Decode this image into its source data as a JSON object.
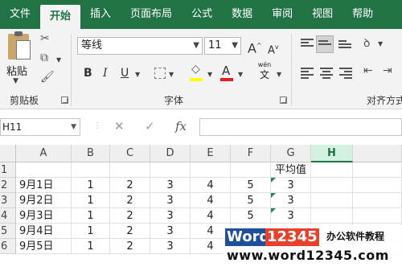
{
  "ribbon_tabs": [
    "文件",
    "开始",
    "插入",
    "页面布局",
    "公式",
    "数据",
    "审阅",
    "视图",
    "帮助"
  ],
  "active_tab": "开始",
  "clipboard": {
    "paste_label": "粘贴",
    "group_label": "剪贴板"
  },
  "font": {
    "name": "等线",
    "size": "11",
    "bold": "B",
    "italic": "I",
    "underline": "U",
    "grow": "A",
    "shrink": "A",
    "font_color_letter": "A",
    "phonetic_top": "wén",
    "phonetic_bottom": "文",
    "group_label": "字体",
    "highlight_color": "#ffff00",
    "font_color": "#e02020"
  },
  "alignment": {
    "group_label": "对齐方式"
  },
  "formula_bar": {
    "name_box": "H11",
    "fx_label": "fx",
    "formula": ""
  },
  "grid": {
    "columns": [
      "A",
      "B",
      "C",
      "D",
      "E",
      "F",
      "G",
      "H"
    ],
    "selected_column": "H",
    "rows": [
      {
        "num": "1",
        "cells": [
          "",
          "",
          "",
          "",
          "",
          "",
          "平均值",
          ""
        ]
      },
      {
        "num": "2",
        "cells": [
          "9月1日",
          "1",
          "2",
          "3",
          "4",
          "5",
          "3",
          ""
        ]
      },
      {
        "num": "3",
        "cells": [
          "9月2日",
          "1",
          "2",
          "3",
          "4",
          "5",
          "3",
          ""
        ]
      },
      {
        "num": "4",
        "cells": [
          "9月3日",
          "1",
          "2",
          "3",
          "4",
          "5",
          "3",
          ""
        ]
      },
      {
        "num": "5",
        "cells": [
          "9月4日",
          "1",
          "2",
          "3",
          "4",
          "",
          "",
          ""
        ]
      },
      {
        "num": "6",
        "cells": [
          "9月5日",
          "1",
          "2",
          "3",
          "4",
          "",
          "",
          ""
        ]
      }
    ]
  },
  "watermark": {
    "brand_word": "Word",
    "brand_num": "12345",
    "tagline": "办公软件教程",
    "url": "www.word12345.com",
    "brand_bg": "#1e4f9e",
    "num_bg": "#e8402a"
  },
  "colors": {
    "accent": "#217346"
  }
}
